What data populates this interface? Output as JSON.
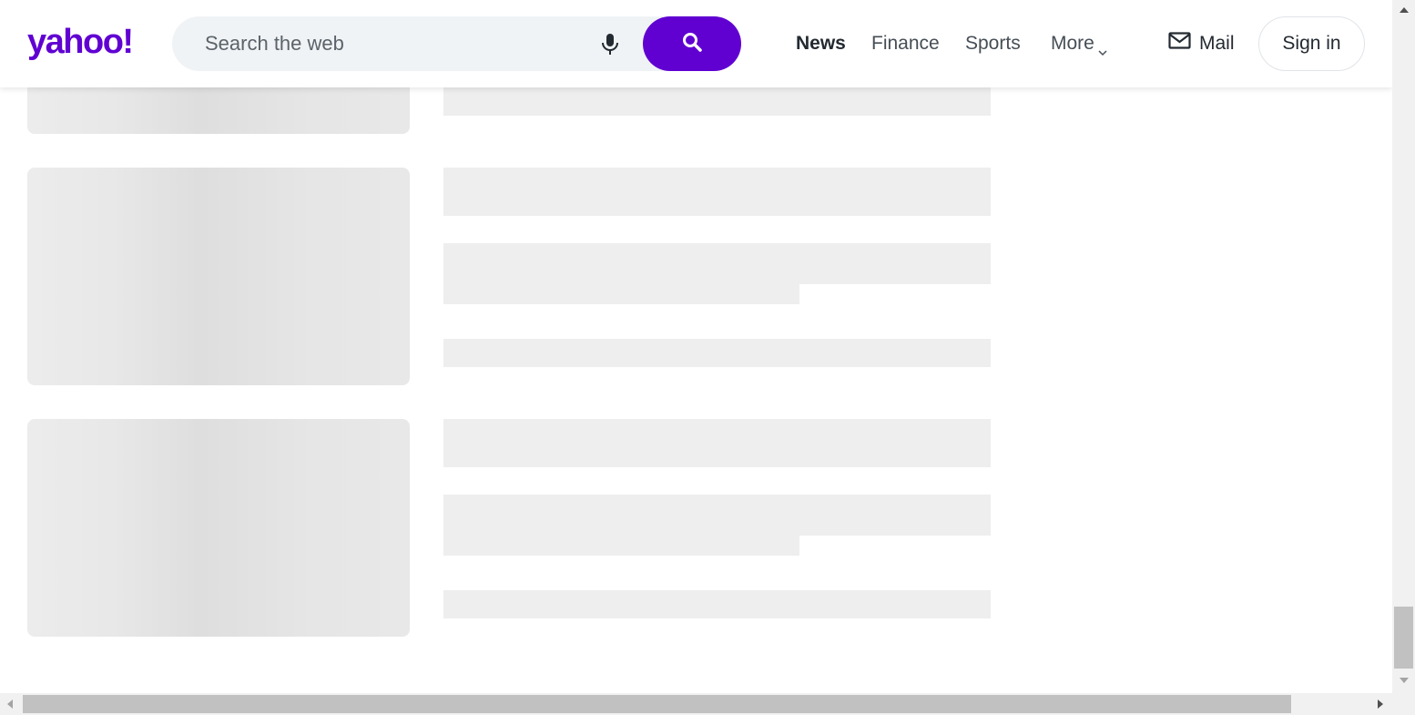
{
  "header": {
    "logo_text": "yahoo!",
    "search": {
      "placeholder": "Search the web",
      "value": ""
    },
    "nav": [
      {
        "label": "News",
        "active": true
      },
      {
        "label": "Finance",
        "active": false
      },
      {
        "label": "Sports",
        "active": false
      },
      {
        "label": "More",
        "active": false
      }
    ],
    "mail_label": "Mail",
    "signin_label": "Sign in"
  },
  "colors": {
    "brand": "#6001d2",
    "search_bg": "#f0f3f5",
    "skeleton": "#eeeeee"
  },
  "icons": [
    "microphone-icon",
    "search-icon",
    "chevron-down-icon",
    "mail-icon"
  ],
  "content": {
    "state": "loading-skeleton",
    "placeholder_cards": 3
  }
}
